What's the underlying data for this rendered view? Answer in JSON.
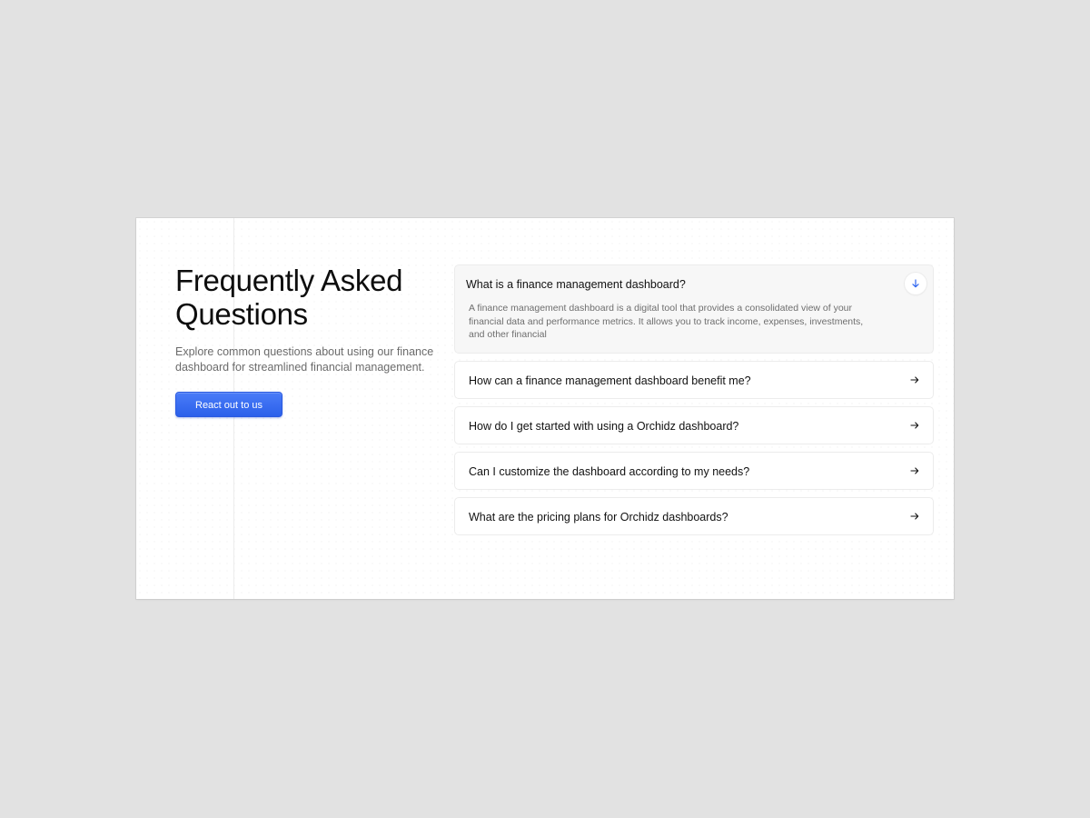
{
  "header": {
    "title": "Frequently Asked\nQuestions",
    "subtitle": "Explore common questions about using our finance\ndashboard for streamlined financial management.",
    "cta_label": "React out to us"
  },
  "faq": [
    {
      "question": "What is a finance management dashboard?",
      "answer": "A finance management dashboard is a digital tool that provides a consolidated view of your financial data and performance metrics. It allows you to track income, expenses, investments, and other financial",
      "expanded": true,
      "icon": "arrow-down-icon"
    },
    {
      "question": "How can a finance management dashboard benefit me?",
      "expanded": false,
      "icon": "arrow-right-icon"
    },
    {
      "question": "How do I get started with using a Orchidz dashboard?",
      "expanded": false,
      "icon": "arrow-right-icon"
    },
    {
      "question": "Can I customize the dashboard according to my needs?",
      "expanded": false,
      "icon": "arrow-right-icon"
    },
    {
      "question": "What are the pricing plans for Orchidz dashboards?",
      "expanded": false,
      "icon": "arrow-right-icon"
    }
  ],
  "colors": {
    "accent": "#2f66f0",
    "background": "#e2e2e2",
    "card": "#ffffff"
  }
}
